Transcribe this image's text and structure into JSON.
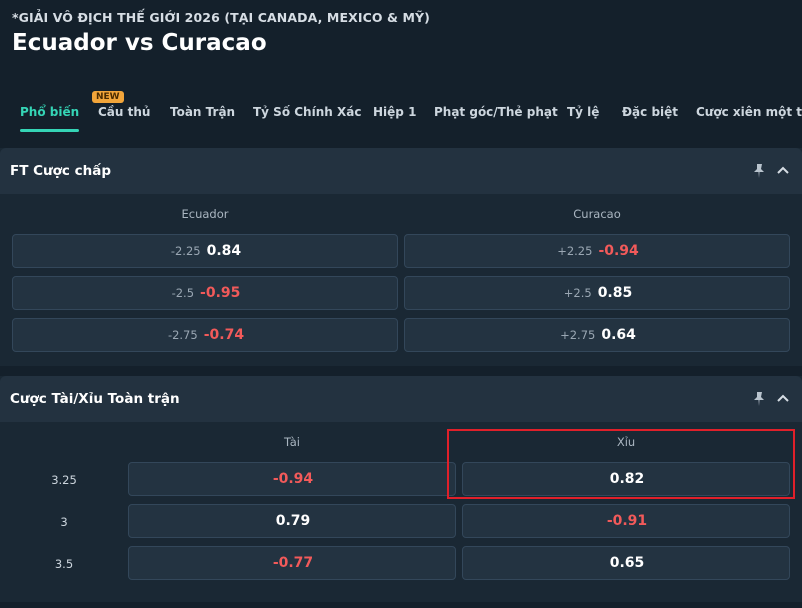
{
  "header": {
    "league": "*GIẢI VÔ ĐỊCH THẾ GIỚI 2026 (TẠI CANADA, MEXICO & MỸ)",
    "match": "Ecuador vs Curacao",
    "new_badge": "NEW",
    "tabs": [
      {
        "label": "Phổ biến",
        "active": true
      },
      {
        "label": "Cầu thủ"
      },
      {
        "label": "Toàn Trận"
      },
      {
        "label": "Tỷ Số Chính Xác"
      },
      {
        "label": "Hiệp 1"
      },
      {
        "label": "Phạt góc/Thẻ phạt"
      },
      {
        "label": "Tỷ lệ"
      },
      {
        "label": "Đặc biệt"
      },
      {
        "label": "Cược xiên một trận"
      }
    ]
  },
  "handicap": {
    "title": "FT Cược chấp",
    "home": "Ecuador",
    "away": "Curacao",
    "rows": [
      {
        "home_line": "-2.25",
        "home_odds": "0.84",
        "away_line": "+2.25",
        "away_odds": "-0.94"
      },
      {
        "home_line": "-2.5",
        "home_odds": "-0.95",
        "away_line": "+2.5",
        "away_odds": "0.85"
      },
      {
        "home_line": "-2.75",
        "home_odds": "-0.74",
        "away_line": "+2.75",
        "away_odds": "0.64"
      }
    ]
  },
  "overunder": {
    "title": "Cược Tài/Xỉu Toàn trận",
    "over": "Tài",
    "under": "Xỉu",
    "rows": [
      {
        "line": "3.25",
        "over_odds": "-0.94",
        "under_odds": "0.82"
      },
      {
        "line": "3",
        "over_odds": "0.79",
        "under_odds": "-0.91"
      },
      {
        "line": "3.5",
        "over_odds": "-0.77",
        "under_odds": "0.65"
      }
    ]
  },
  "colors": {
    "accent": "#35d5b6",
    "negative": "#f25a5a",
    "highlight": "#e0202a"
  }
}
